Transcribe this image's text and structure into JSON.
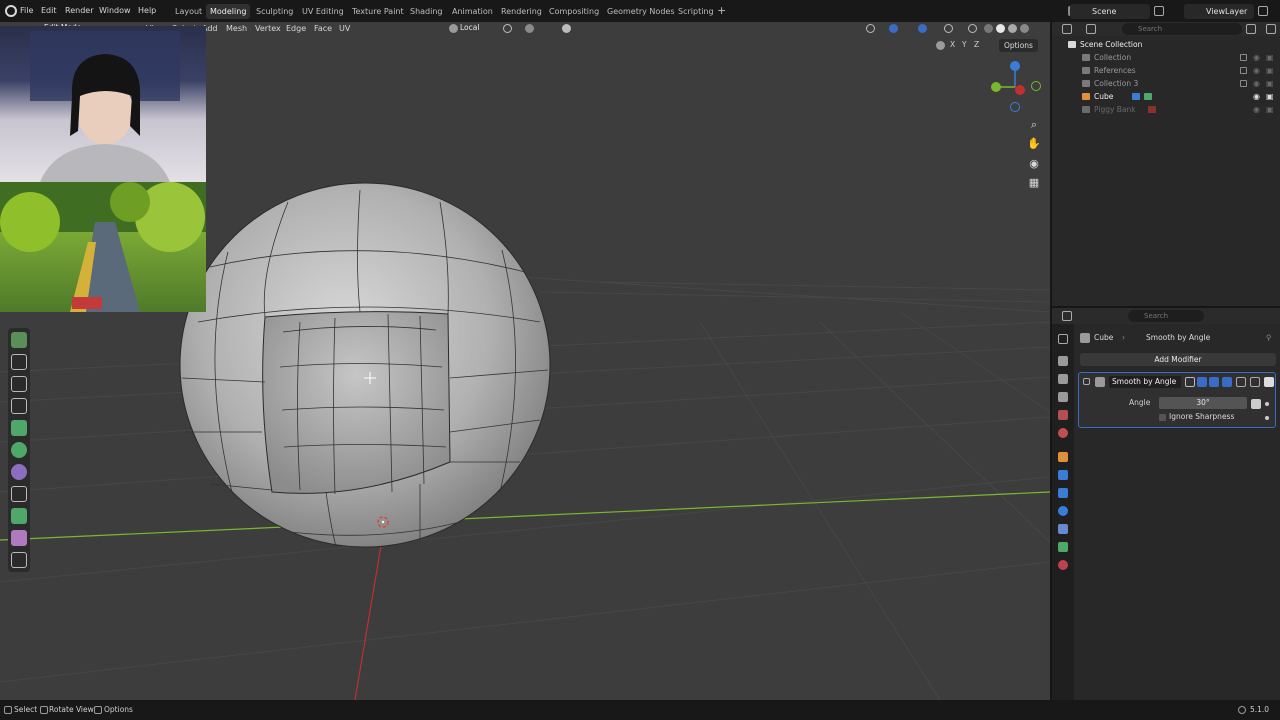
{
  "topbar": {
    "menus": [
      "File",
      "Edit",
      "Render",
      "Window",
      "Help"
    ],
    "workspaces": [
      "Layout",
      "Modeling",
      "Sculpting",
      "UV Editing",
      "Texture Paint",
      "Shading",
      "Animation",
      "Rendering",
      "Compositing",
      "Geometry Nodes",
      "Scripting"
    ],
    "active_workspace": "Modeling",
    "add_workspace": "+",
    "scene": "Scene",
    "view_layer": "ViewLayer"
  },
  "viewport": {
    "mode": "Edit Mode",
    "menus": [
      "View",
      "Select",
      "Add",
      "Mesh",
      "Vertex",
      "Edge",
      "Face",
      "UV"
    ],
    "transform_orientation": "Local",
    "options_label": "Options",
    "axis_x": "X",
    "axis_y": "Y",
    "axis_z": "Z"
  },
  "outliner": {
    "search_placeholder": "Search",
    "root": "Scene Collection",
    "items": [
      {
        "label": "Collection",
        "active": false
      },
      {
        "label": "References",
        "active": false
      },
      {
        "label": "Collection 3",
        "active": false
      },
      {
        "label": "Cube",
        "active": true
      },
      {
        "label": "Piggy Bank",
        "active": false
      }
    ]
  },
  "properties": {
    "search_placeholder": "Search",
    "breadcrumb_object": "Cube",
    "breadcrumb_modifier": "Smooth by Angle",
    "add_modifier": "Add Modifier",
    "modifier": {
      "name": "Smooth by Angle",
      "angle_label": "Angle",
      "angle_value": "30°",
      "ignore_sharpness_label": "Ignore Sharpness",
      "ignore_sharpness": false
    }
  },
  "statusbar": {
    "select": "Select",
    "rotate_view": "Rotate View",
    "options": "Options",
    "version": "5.1.0"
  },
  "colors": {
    "accent": "#3a6cc6",
    "x_axis": "#c03030",
    "y_axis": "#7cb82f",
    "z_axis": "#3a7dd8"
  }
}
